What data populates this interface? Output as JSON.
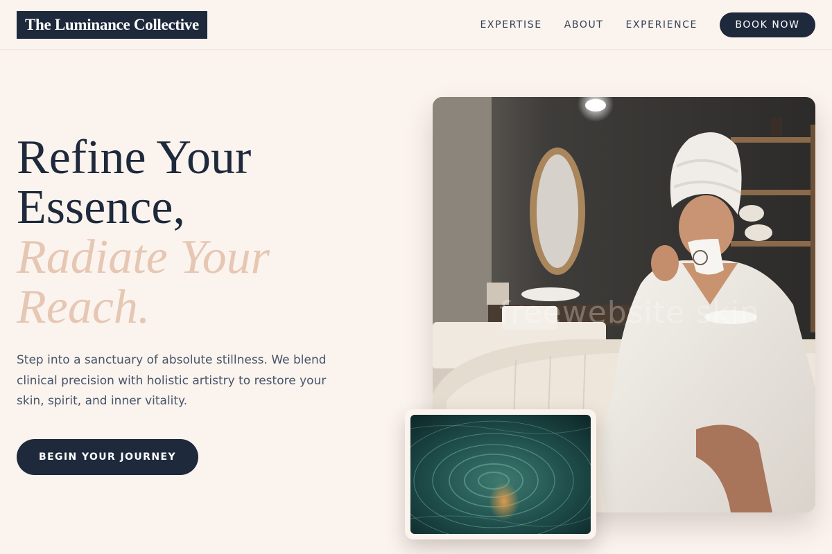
{
  "brand": {
    "name": "The Luminance Collective"
  },
  "nav": {
    "links": [
      "EXPERTISE",
      "ABOUT",
      "EXPERIENCE"
    ],
    "book_label": "BOOK NOW"
  },
  "hero": {
    "headline_line1": "Refine Your",
    "headline_line2": "Essence,",
    "headline_accent1": "Radiate Your",
    "headline_accent2": "Reach.",
    "intro": "Step into a sanctuary of absolute stillness. We blend clinical precision with holistic artistry to restore your skin, spirit, and inner vitality.",
    "cta_label": "BEGIN YOUR JOURNEY"
  },
  "images": {
    "main_watermark": "freewebsite skin"
  },
  "colors": {
    "background": "#fbf3ee",
    "navy": "#1e293b",
    "accent": "#e6c7b3",
    "body_text": "#475569"
  }
}
